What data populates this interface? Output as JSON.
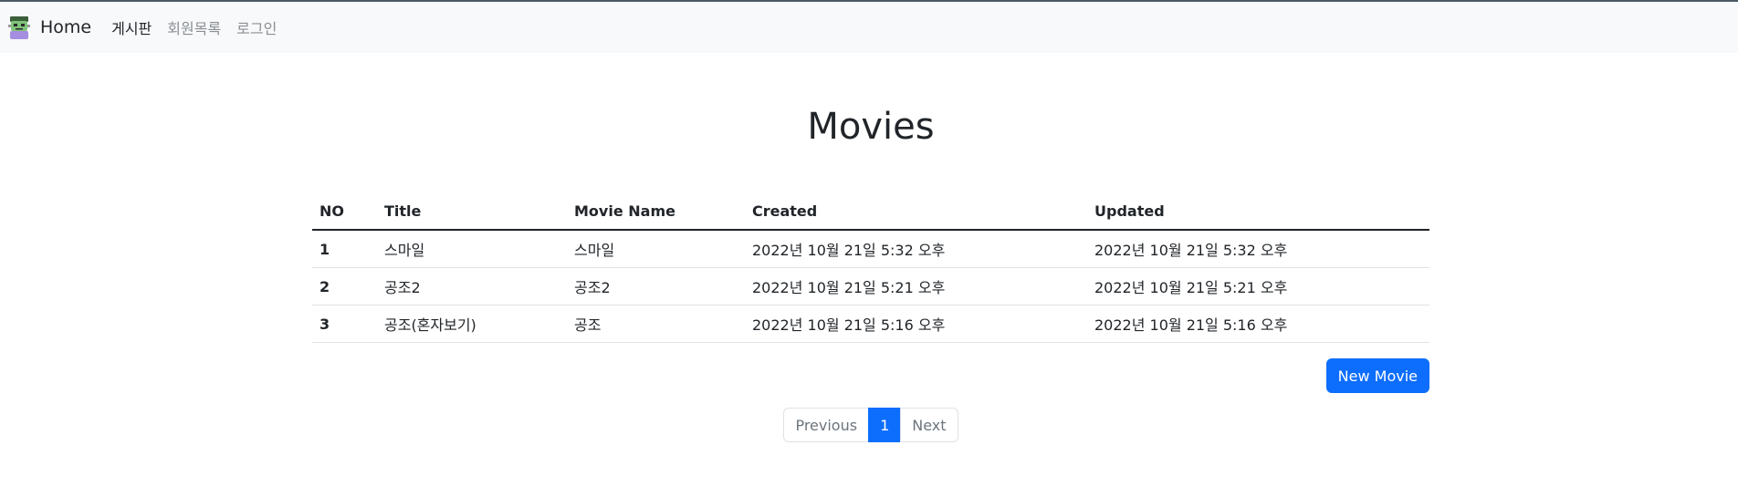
{
  "navbar": {
    "brand": "Home",
    "links": [
      {
        "label": "게시판",
        "active": true
      },
      {
        "label": "회원목록",
        "active": false
      },
      {
        "label": "로그인",
        "active": false
      }
    ]
  },
  "page": {
    "title": "Movies"
  },
  "table": {
    "headers": [
      "NO",
      "Title",
      "Movie Name",
      "Created",
      "Updated"
    ],
    "rows": [
      {
        "no": "1",
        "title": "스마일",
        "movie_name": "스마일",
        "created": "2022년 10월 21일 5:32 오후",
        "updated": "2022년 10월 21일 5:32 오후"
      },
      {
        "no": "2",
        "title": "공조2",
        "movie_name": "공조2",
        "created": "2022년 10월 21일 5:21 오후",
        "updated": "2022년 10월 21일 5:21 오후"
      },
      {
        "no": "3",
        "title": "공조(혼자보기)",
        "movie_name": "공조",
        "created": "2022년 10월 21일 5:16 오후",
        "updated": "2022년 10월 21일 5:16 오후"
      }
    ]
  },
  "actions": {
    "new_movie_label": "New Movie"
  },
  "pagination": {
    "previous_label": "Previous",
    "current_page": "1",
    "next_label": "Next"
  },
  "colors": {
    "primary": "#0d6efd",
    "navbar_bg": "#f8f9fa",
    "text": "#212529",
    "muted": "#8a8f94"
  }
}
